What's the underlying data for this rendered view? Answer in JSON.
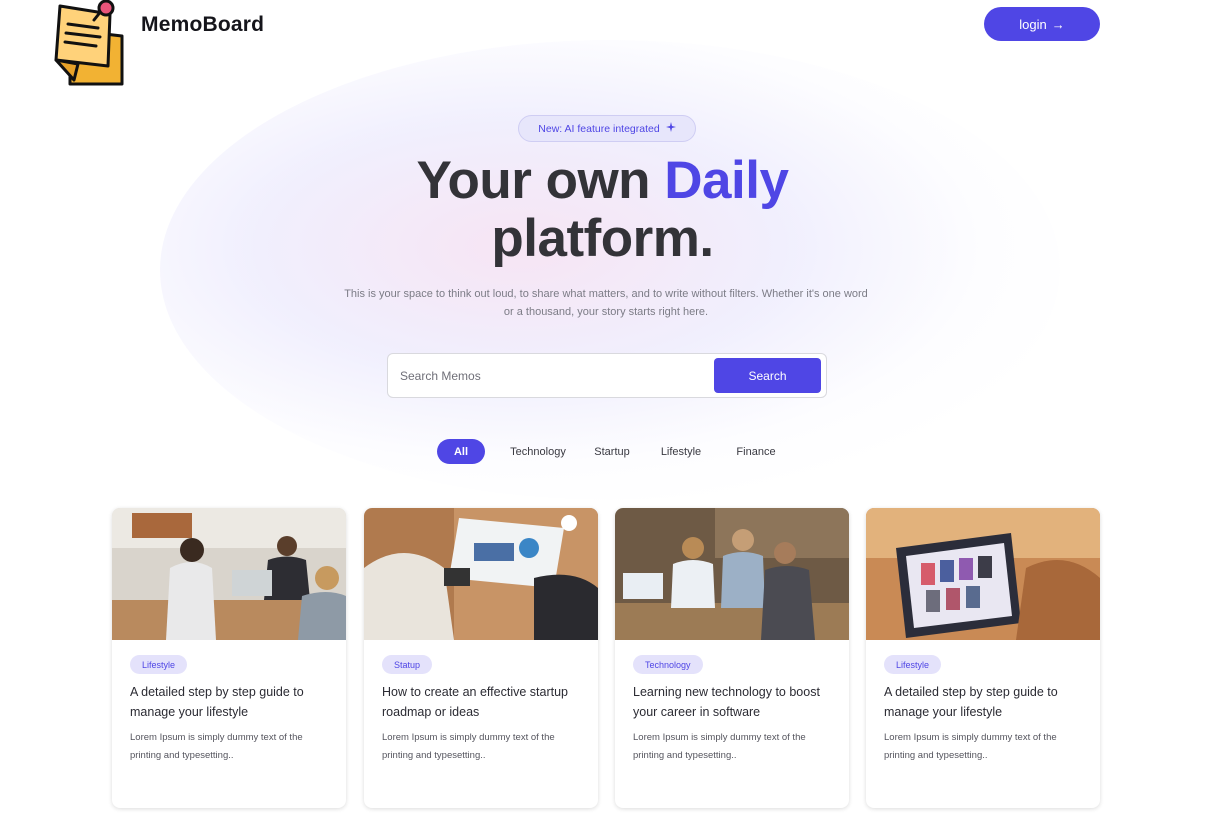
{
  "header": {
    "brand": "MemoBoard",
    "login_label": "login",
    "login_arrow": "→"
  },
  "hero": {
    "badge_text": "New: AI feature integrated",
    "badge_icon": "sparkle-icon",
    "title_part1": "Your own ",
    "title_accent": "Daily",
    "title_part2": "platform.",
    "subtitle": "This is your space to think out loud, to share what matters, and to write without filters. Whether it's one word or a thousand, your story starts right here."
  },
  "search": {
    "placeholder": "Search Memos",
    "value": "",
    "button_label": "Search"
  },
  "filters": [
    {
      "label": "All",
      "active": true
    },
    {
      "label": "Technology",
      "active": false
    },
    {
      "label": "Startup",
      "active": false
    },
    {
      "label": "Lifestyle",
      "active": false
    },
    {
      "label": "Finance",
      "active": false
    }
  ],
  "cards": [
    {
      "tag": "Lifestyle",
      "title": "A detailed step by step guide to manage your lifestyle",
      "desc": "Lorem Ipsum is simply dummy text of the printing and typesetting.."
    },
    {
      "tag": "Statup",
      "title": "How to create an effective startup roadmap or ideas",
      "desc": "Lorem Ipsum is simply dummy text of the printing and typesetting.."
    },
    {
      "tag": "Technology",
      "title": "Learning new technology to boost your career in software",
      "desc": "Lorem Ipsum is simply dummy text of the printing and typesetting.."
    },
    {
      "tag": "Lifestyle",
      "title": "A detailed step by step guide to manage your lifestyle",
      "desc": "Lorem Ipsum is simply dummy text of the printing and typesetting.."
    }
  ],
  "colors": {
    "accent": "#4f46e5",
    "tag_bg": "#e4e2fb",
    "text_dark": "#333338"
  }
}
